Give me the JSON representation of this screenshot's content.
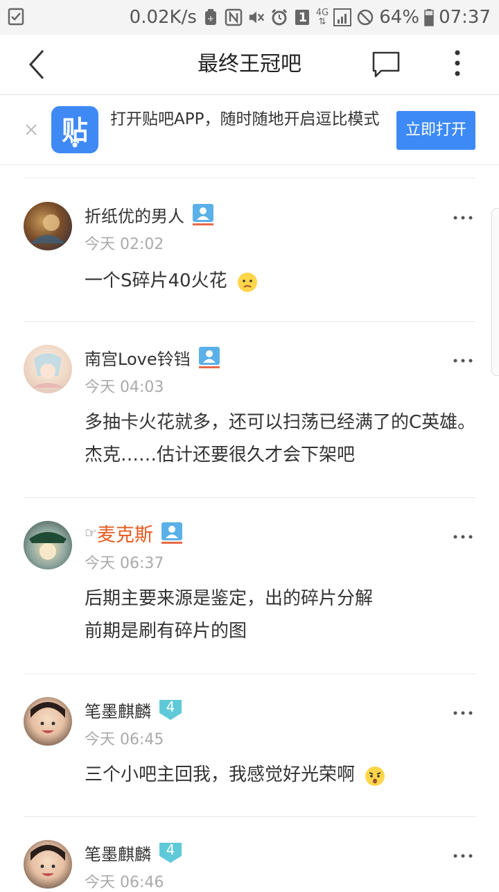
{
  "status_bar": {
    "speed": "0.02K/s",
    "sim_number": "1",
    "network": "4G",
    "battery": "64%",
    "time": "07:37"
  },
  "nav": {
    "title": "最终王冠吧"
  },
  "banner": {
    "app_glyph": "贴",
    "text": "打开贴吧APP，随时随地开启逗比模式",
    "button": "立即打开"
  },
  "posts": [
    {
      "name": "折纸优的男人",
      "time": "今天 02:02",
      "content": "一个S碎片40火花",
      "emoji": "worried-face-emoji"
    },
    {
      "name": "南宫Love铃铛",
      "time": "今天 04:03",
      "content": "多抽卡火花就多，还可以扫荡已经满了的C英雄。杰克……估计还要很久才会下架吧"
    },
    {
      "name_prefix": "☞",
      "name": "麦克斯",
      "time": "今天 06:37",
      "content_line1": "后期主要来源是鉴定，出的碎片分解",
      "content_line2": "前期是刷有碎片的图"
    },
    {
      "name": "笔墨麒麟",
      "level": "4",
      "time": "今天 06:45",
      "content": "三个小吧主回我，我感觉好光荣啊",
      "emoji": "shocked-face-emoji"
    },
    {
      "name": "笔墨麒麟",
      "level": "4",
      "time": "今天 06:46"
    }
  ]
}
